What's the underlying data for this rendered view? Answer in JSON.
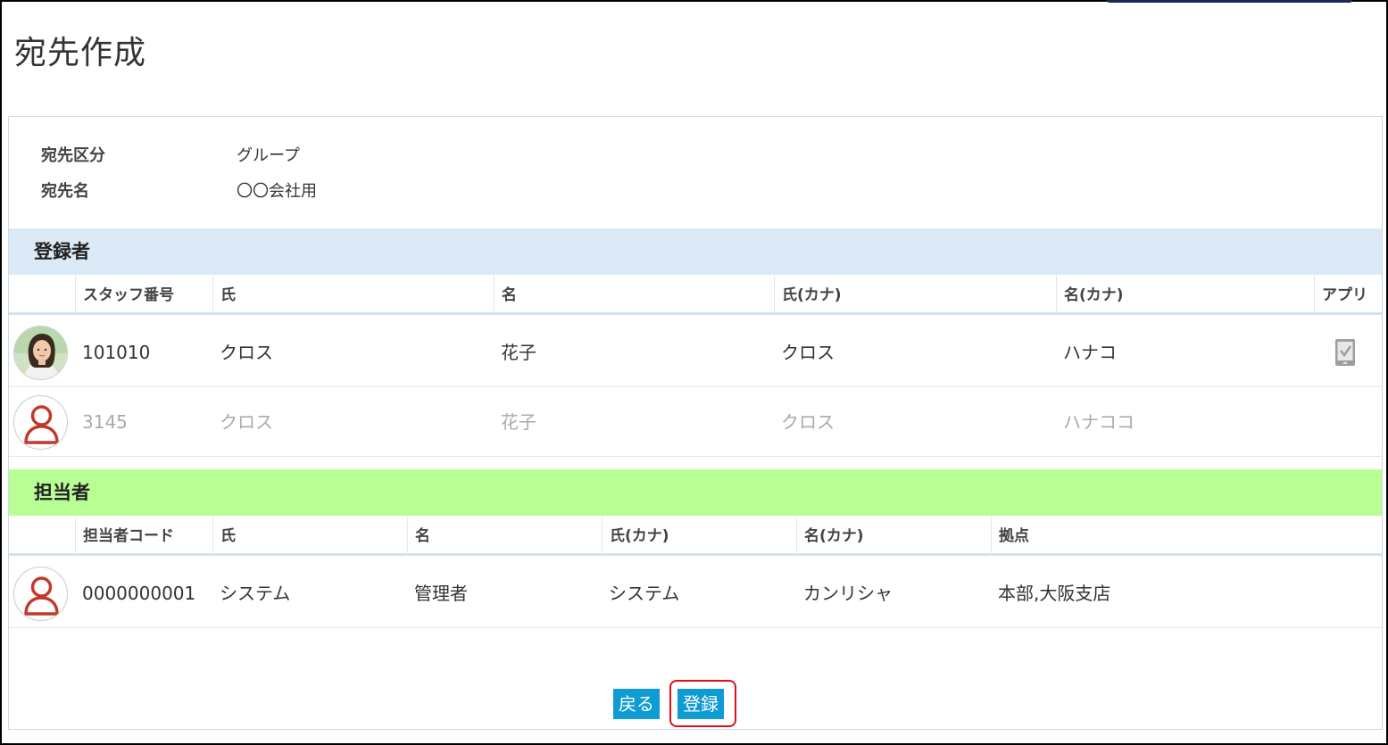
{
  "page": {
    "title": "宛先作成"
  },
  "info": {
    "type_label": "宛先区分",
    "type_value": "グループ",
    "name_label": "宛先名",
    "name_value": "〇〇会社用"
  },
  "registrants": {
    "heading": "登録者",
    "columns": [
      "スタッフ番号",
      "氏",
      "名",
      "氏(カナ)",
      "名(カナ)",
      "アプリ"
    ],
    "rows": [
      {
        "avatar": "user-photo",
        "staff_no": "101010",
        "last": "クロス",
        "first": "花子",
        "last_kana": "クロス",
        "first_kana": "ハナコ",
        "app": "mobile-check-icon",
        "disabled": false
      },
      {
        "avatar": "person-placeholder-icon",
        "staff_no": "3145",
        "last": "クロス",
        "first": "花子",
        "last_kana": "クロス",
        "first_kana": "ハナココ",
        "app": "",
        "disabled": true
      }
    ]
  },
  "managers": {
    "heading": "担当者",
    "columns": [
      "担当者コード",
      "氏",
      "名",
      "氏(カナ)",
      "名(カナ)",
      "拠点"
    ],
    "rows": [
      {
        "avatar": "person-placeholder-icon",
        "code": "0000000001",
        "last": "システム",
        "first": "管理者",
        "last_kana": "システム",
        "first_kana": "カンリシャ",
        "base": "本部,大阪支店"
      }
    ]
  },
  "actions": {
    "back_label": "戻る",
    "register_label": "登録"
  },
  "colors": {
    "button": "#0f9bd3",
    "registrant_header": "#dce9f7",
    "manager_header": "#b9fd95",
    "highlight": "#e0101b",
    "avatar_icon": "#c0392b"
  }
}
